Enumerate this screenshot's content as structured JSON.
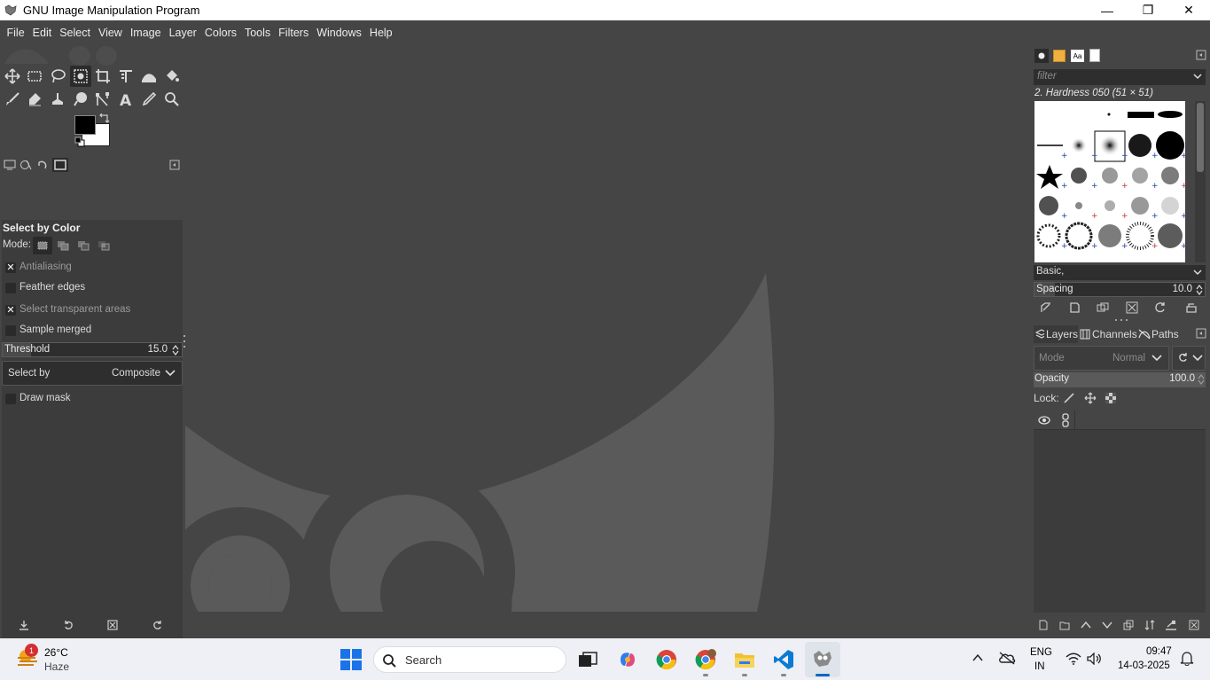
{
  "window": {
    "title": "GNU Image Manipulation Program",
    "minimize": "—",
    "maximize": "❐",
    "close": "✕"
  },
  "menu": [
    "File",
    "Edit",
    "Select",
    "View",
    "Image",
    "Layer",
    "Colors",
    "Tools",
    "Filters",
    "Windows",
    "Help"
  ],
  "tool_options": {
    "title": "Select by Color",
    "mode_label": "Mode:",
    "antialiasing": {
      "label": "Antialiasing",
      "checked": true
    },
    "feather_edges": {
      "label": "Feather edges",
      "checked": false
    },
    "select_transparent": {
      "label": "Select transparent areas",
      "checked": true
    },
    "sample_merged": {
      "label": "Sample merged",
      "checked": false
    },
    "threshold": {
      "label": "Threshold",
      "value": "15.0"
    },
    "select_by": {
      "label": "Select by",
      "value": "Composite"
    },
    "draw_mask": {
      "label": "Draw mask",
      "checked": false
    }
  },
  "brushes": {
    "filter_placeholder": "filter",
    "current_brush": "2. Hardness 050 (51 × 51)",
    "tag": "Basic,",
    "spacing_label": "Spacing",
    "spacing_value": "10.0"
  },
  "layers": {
    "tabs": [
      "Layers",
      "Channels",
      "Paths"
    ],
    "mode_placeholder": "Mode",
    "mode_value": "Normal",
    "opacity_label": "Opacity",
    "opacity_value": "100.0",
    "lock_label": "Lock:"
  },
  "taskbar": {
    "weather_temp": "26°C",
    "weather_desc": "Haze",
    "weather_badge": "1",
    "search_placeholder": "Search",
    "lang": "ENG",
    "region": "IN",
    "time": "09:47",
    "date": "14-03-2025"
  },
  "colors": {
    "accent": "#0067c0",
    "bg": "#454545",
    "panel": "#3c3c3c"
  }
}
